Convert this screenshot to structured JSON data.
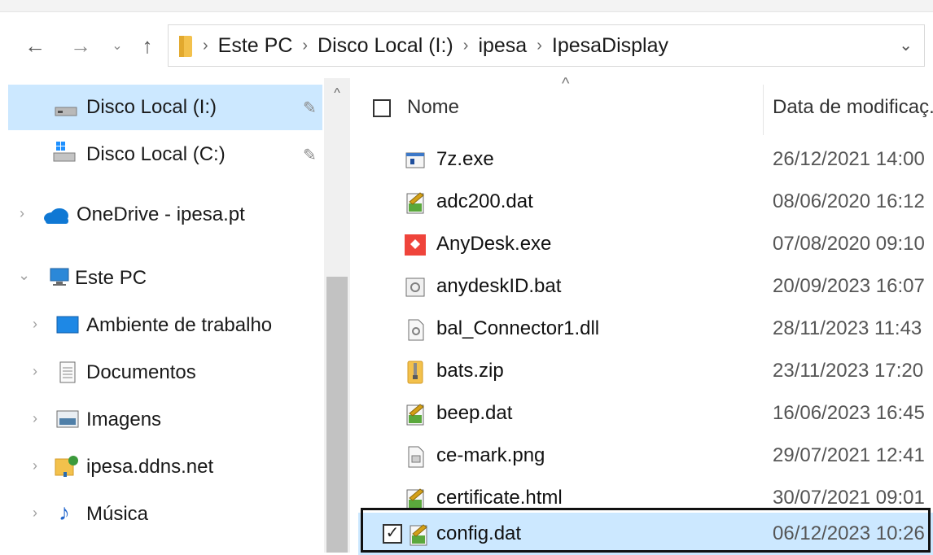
{
  "nav": {
    "back_icon": "arrow-left-icon",
    "forward_icon": "arrow-right-icon",
    "recent_icon": "chevron-down-icon",
    "up_icon": "arrow-up-icon"
  },
  "address": {
    "folder_icon": "folder-icon",
    "breadcrumbs": [
      "Este PC",
      "Disco Local (I:)",
      "ipesa",
      "IpesaDisplay"
    ],
    "separator": "›",
    "dropdown_icon": "chevron-down-icon"
  },
  "sidebar": {
    "items": [
      {
        "label": "Disco Local (I:)",
        "icon": "drive-icon",
        "pinned": true,
        "selected": true
      },
      {
        "label": "Disco Local (C:)",
        "icon": "windows-drive-icon",
        "pinned": true
      },
      {
        "label": "OneDrive - ipesa.pt",
        "icon": "cloud-icon",
        "expandable": true
      },
      {
        "label": "Este PC",
        "icon": "computer-icon",
        "expanded": true
      },
      {
        "label": "Ambiente de trabalho",
        "icon": "desktop-icon",
        "expandable": true
      },
      {
        "label": "Documentos",
        "icon": "document-icon",
        "expandable": true
      },
      {
        "label": "Imagens",
        "icon": "pictures-icon",
        "expandable": true
      },
      {
        "label": "ipesa.ddns.net",
        "icon": "network-folder-icon",
        "expandable": true
      },
      {
        "label": "Música",
        "icon": "music-icon",
        "expandable": true
      }
    ]
  },
  "columns": {
    "name": "Nome",
    "date": "Data de modificaç..."
  },
  "files": [
    {
      "name": "7z.exe",
      "date": "26/12/2021 14:00",
      "icon": "exe-icon"
    },
    {
      "name": "adc200.dat",
      "date": "08/06/2020 16:12",
      "icon": "dat-file-icon"
    },
    {
      "name": "AnyDesk.exe",
      "date": "07/08/2020 09:10",
      "icon": "anydesk-icon"
    },
    {
      "name": "anydeskID.bat",
      "date": "20/09/2023 16:07",
      "icon": "bat-file-icon"
    },
    {
      "name": "bal_Connector1.dll",
      "date": "28/11/2023 11:43",
      "icon": "dll-file-icon"
    },
    {
      "name": "bats.zip",
      "date": "23/11/2023 17:20",
      "icon": "zip-folder-icon"
    },
    {
      "name": "beep.dat",
      "date": "16/06/2023 16:45",
      "icon": "dat-file-icon"
    },
    {
      "name": "ce-mark.png",
      "date": "29/07/2021 12:41",
      "icon": "image-file-icon"
    },
    {
      "name": "certificate.html",
      "date": "30/07/2021 09:01",
      "icon": "dat-file-icon"
    },
    {
      "name": "config.dat",
      "date": "06/12/2023 10:26",
      "icon": "dat-file-icon",
      "selected": true,
      "checked": true
    }
  ],
  "colors": {
    "selection": "#cce8ff",
    "anydesk_red": "#ef443b",
    "folder_yellow": "#f3c14c",
    "onedrive_blue": "#0f78d4"
  }
}
